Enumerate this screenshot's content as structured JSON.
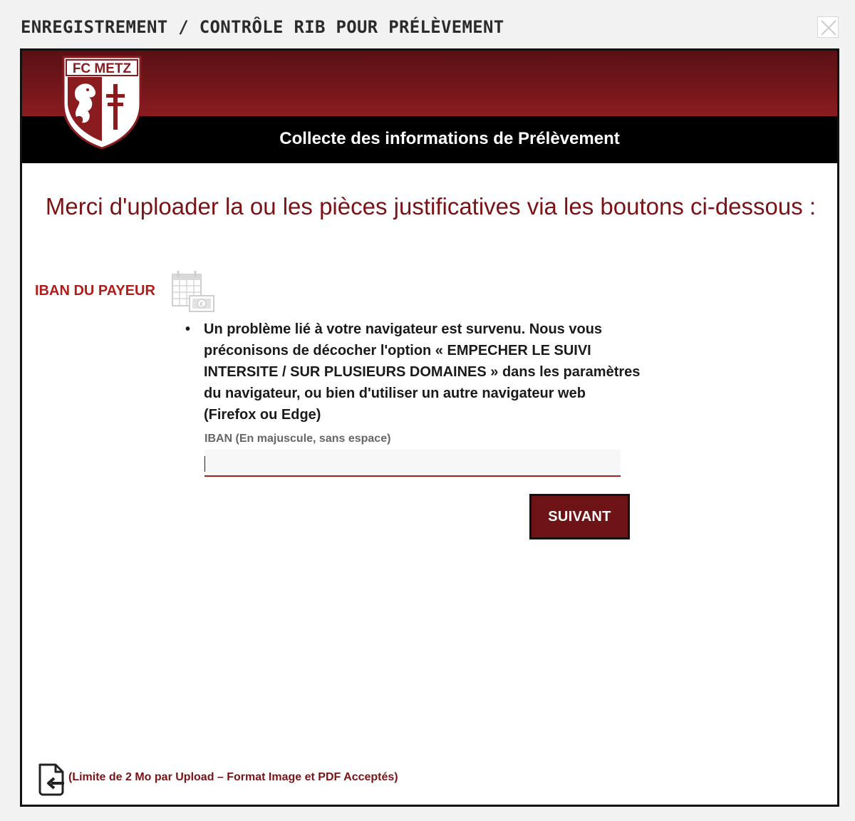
{
  "modal": {
    "title": "ENREGISTREMENT / CONTRÔLE RIB POUR PRÉLÈVEMENT",
    "close_icon": "close-icon"
  },
  "brand": {
    "logo_text": "FC METZ",
    "colors": {
      "primary": "#7a1316",
      "banner_dark": "#000000",
      "label_red": "#b01d1a"
    }
  },
  "banner": {
    "title": "Collecte des informations de Prélèvement"
  },
  "main": {
    "heading": "Merci d'uploader la ou les pièces justificatives via les boutons ci-dessous :",
    "iban_section_label": "IBAN DU PAYEUR",
    "iban_section_icon": "calendar-euro-icon",
    "messages": [
      "Un problème lié à votre navigateur est survenu. Nous vous préconisons de décocher l'option « EMPECHER LE SUIVI INTERSITE / SUR PLUSIEURS DOMAINES » dans les paramètres du navigateur, ou bien d'utiliser un autre navigateur web (Firefox ou Edge)"
    ],
    "iban_field": {
      "label": "IBAN (En majuscule, sans espace)",
      "value": "",
      "placeholder": ""
    },
    "next_button": "SUIVANT"
  },
  "footer": {
    "upload_icon": "file-upload-icon",
    "note": "(Limite de 2 Mo par Upload – Format Image et PDF Acceptés)"
  }
}
